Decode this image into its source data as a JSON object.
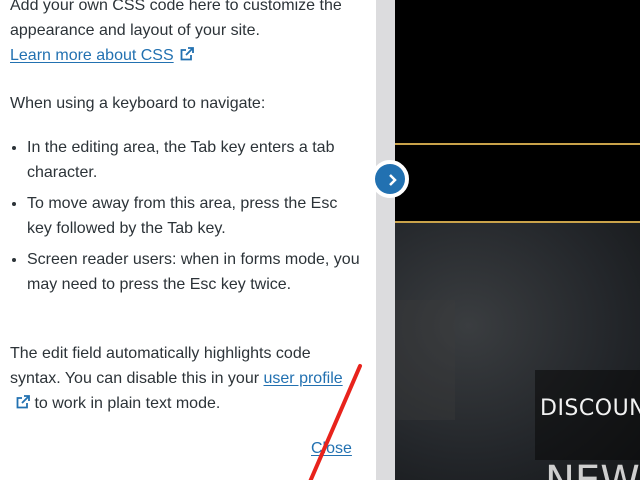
{
  "help": {
    "intro_text": "Add your own CSS code here to customize the appearance and layout of your site.",
    "learn_link": "Learn more about CSS",
    "keyboard_intro": "When using a keyboard to navigate:",
    "tips": [
      "In the editing area, the Tab key enters a tab character.",
      "To move away from this area, press the Esc key followed by the Tab key.",
      "Screen reader users: when in forms mode, you may need to press the Esc key twice."
    ],
    "syntax_prefix": "The edit field automatically highlights code syntax. You can disable this in your",
    "profile_link": "user profile",
    "syntax_suffix": "to work in plain text mode.",
    "close_label": "Close"
  },
  "preview": {
    "discount_text": "DISCOUNT",
    "big_text": "NEW"
  },
  "icons": {
    "external": "external-link-icon",
    "nav": "chevron-right-icon"
  },
  "colors": {
    "link": "#2271b1",
    "text": "#2c3338",
    "gold": "#c9a24a",
    "annotation": "#e8231c"
  }
}
